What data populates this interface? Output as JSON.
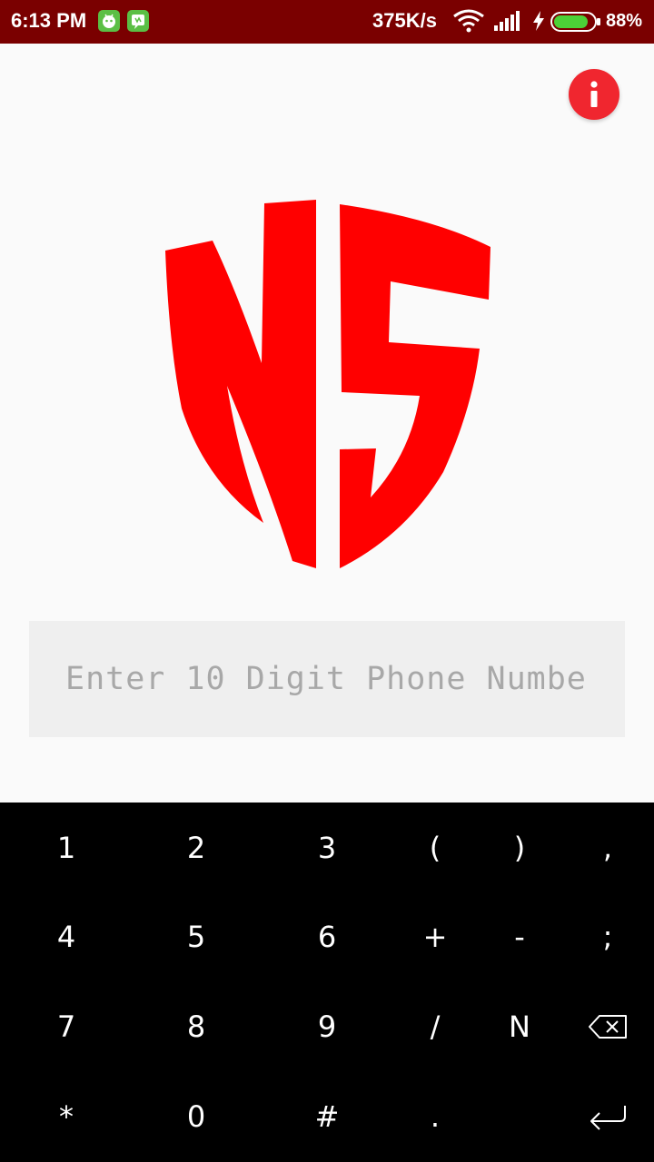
{
  "status_bar": {
    "time": "6:13 PM",
    "net_speed": "375K/s",
    "battery_percent": "88%",
    "battery_level": 0.88,
    "icons": [
      "android-robot-icon",
      "chat-app-icon",
      "wifi-icon",
      "cellular-signal-icon",
      "charging-bolt-icon",
      "battery-icon"
    ],
    "background_color": "#7a0000",
    "battery_fill_color": "#4cd137"
  },
  "info_button": {
    "icon": "info-icon",
    "color": "#f0262f"
  },
  "logo": {
    "icon": "ns-shield-logo",
    "color": "#ff0000"
  },
  "phone_input": {
    "placeholder": "Enter 10 Digit Phone Numbe",
    "value": ""
  },
  "keyboard": {
    "row1": [
      "1",
      "2",
      "3",
      "(",
      ")",
      ","
    ],
    "row2": [
      "4",
      "5",
      "6",
      "+",
      "-",
      ";"
    ],
    "row3": [
      "7",
      "8",
      "9",
      "/",
      "N"
    ],
    "row4": [
      "*",
      "0",
      "#",
      "."
    ],
    "backspace_icon": "backspace-icon",
    "enter_icon": "enter-icon"
  }
}
